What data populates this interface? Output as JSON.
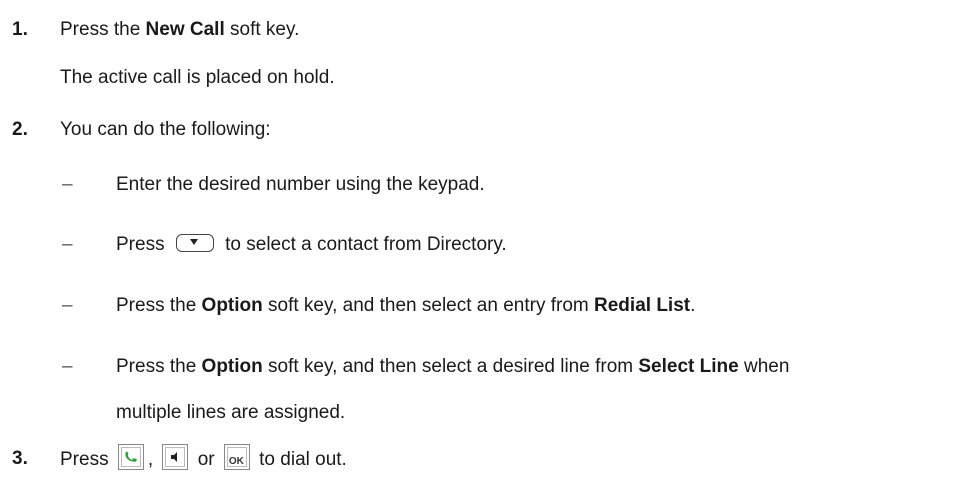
{
  "steps": [
    {
      "num": "1.",
      "pre": "Press the ",
      "bold": "New Call",
      "post": " soft key.",
      "note": "The active call is placed on hold."
    },
    {
      "num": "2.",
      "text": "You can do the following:",
      "items": [
        {
          "text": "Enter the desired number using the keypad."
        },
        {
          "pre": "Press ",
          "post": " to select a contact from Directory."
        },
        {
          "pre": "Press the ",
          "bold1": "Option",
          "mid": " soft key, and then select an entry from ",
          "bold2": "Redial List",
          "post": "."
        },
        {
          "pre": "Press the ",
          "bold1": "Option",
          "mid": " soft key, and then select a desired line from ",
          "bold2": "Select Line",
          "post": " when",
          "cont": "multiple lines are assigned."
        }
      ]
    },
    {
      "num": "3.",
      "pre": "Press ",
      "sep1": ", ",
      "sep2": " or ",
      "post": " to dial out."
    }
  ],
  "dash": "–",
  "icons": [
    "down-navigation-key-icon",
    "off-hook-handset-key-icon",
    "speakerphone-key-icon",
    "ok-key-icon"
  ],
  "ok_label": "OK"
}
